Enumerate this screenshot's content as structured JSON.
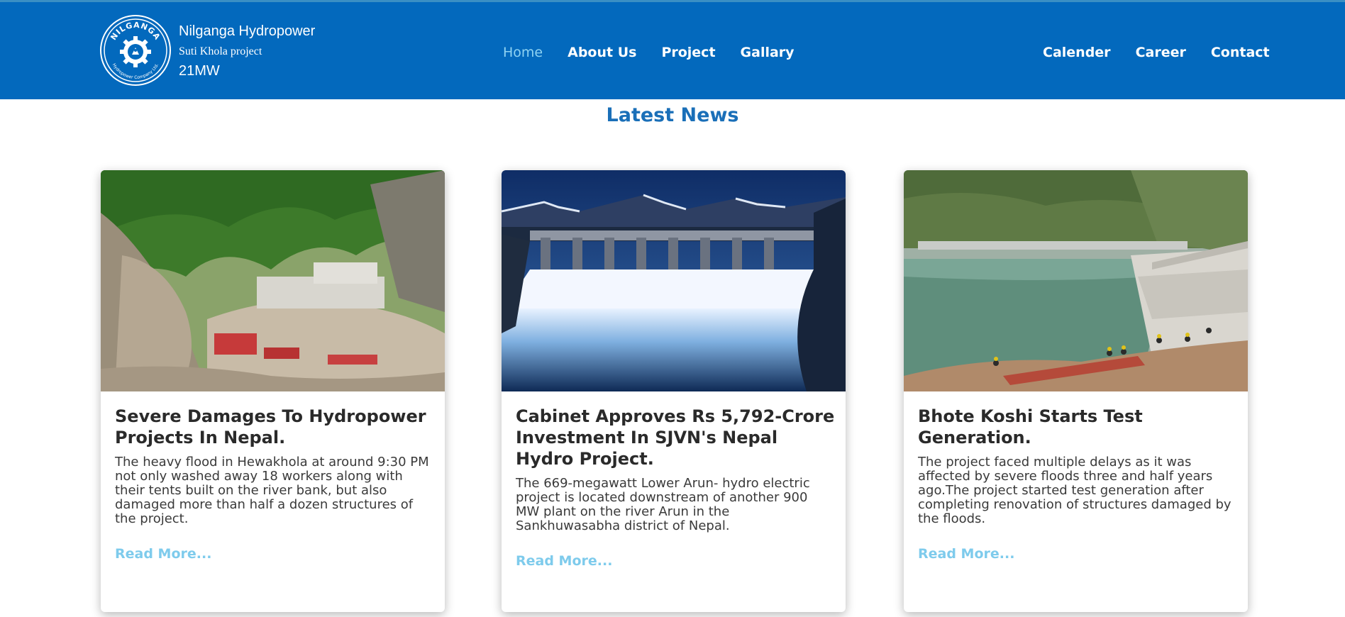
{
  "header": {
    "brand_name": "Nilganga Hydropower",
    "brand_sub": "Suti Khola project",
    "brand_capacity": "21MW",
    "logo_text_top": "NILGANGA",
    "logo_text_bottom": "Hydropower Company Ltd.",
    "nav_left": [
      {
        "label": "Home",
        "active": true
      },
      {
        "label": "About Us",
        "active": false
      },
      {
        "label": "Project",
        "active": false
      },
      {
        "label": "Gallary",
        "active": false
      }
    ],
    "nav_right": [
      {
        "label": "Calender"
      },
      {
        "label": "Career"
      },
      {
        "label": "Contact"
      }
    ]
  },
  "news": {
    "title": "Latest News",
    "cards": [
      {
        "title": "Severe Damages To Hydropower Projects In Nepal.",
        "text": "The heavy flood in Hewakhola at around 9:30 PM not only washed away 18 workers along with their tents built on the river bank, but also damaged more than half a dozen structures of the project.",
        "link": "Read More..."
      },
      {
        "title": "Cabinet Approves Rs 5,792-Crore Investment In SJVN's Nepal Hydro Project.",
        "text": "The 669-megawatt Lower Arun- hydro electric project is located downstream of another 900 MW plant on the river Arun in the Sankhuwasabha district of Nepal.",
        "link": "Read More..."
      },
      {
        "title": "Bhote Koshi Starts Test Generation.",
        "text": "The project faced multiple delays as it was affected by severe floods three and half years ago.The project started test generation after completing renovation of structures damaged by the floods.",
        "link": "Read More..."
      }
    ]
  },
  "colors": {
    "header_bg": "#0369bd",
    "nav_active": "#8fd3f2",
    "section_title": "#1a6fb8",
    "read_more": "#7ecbec"
  }
}
